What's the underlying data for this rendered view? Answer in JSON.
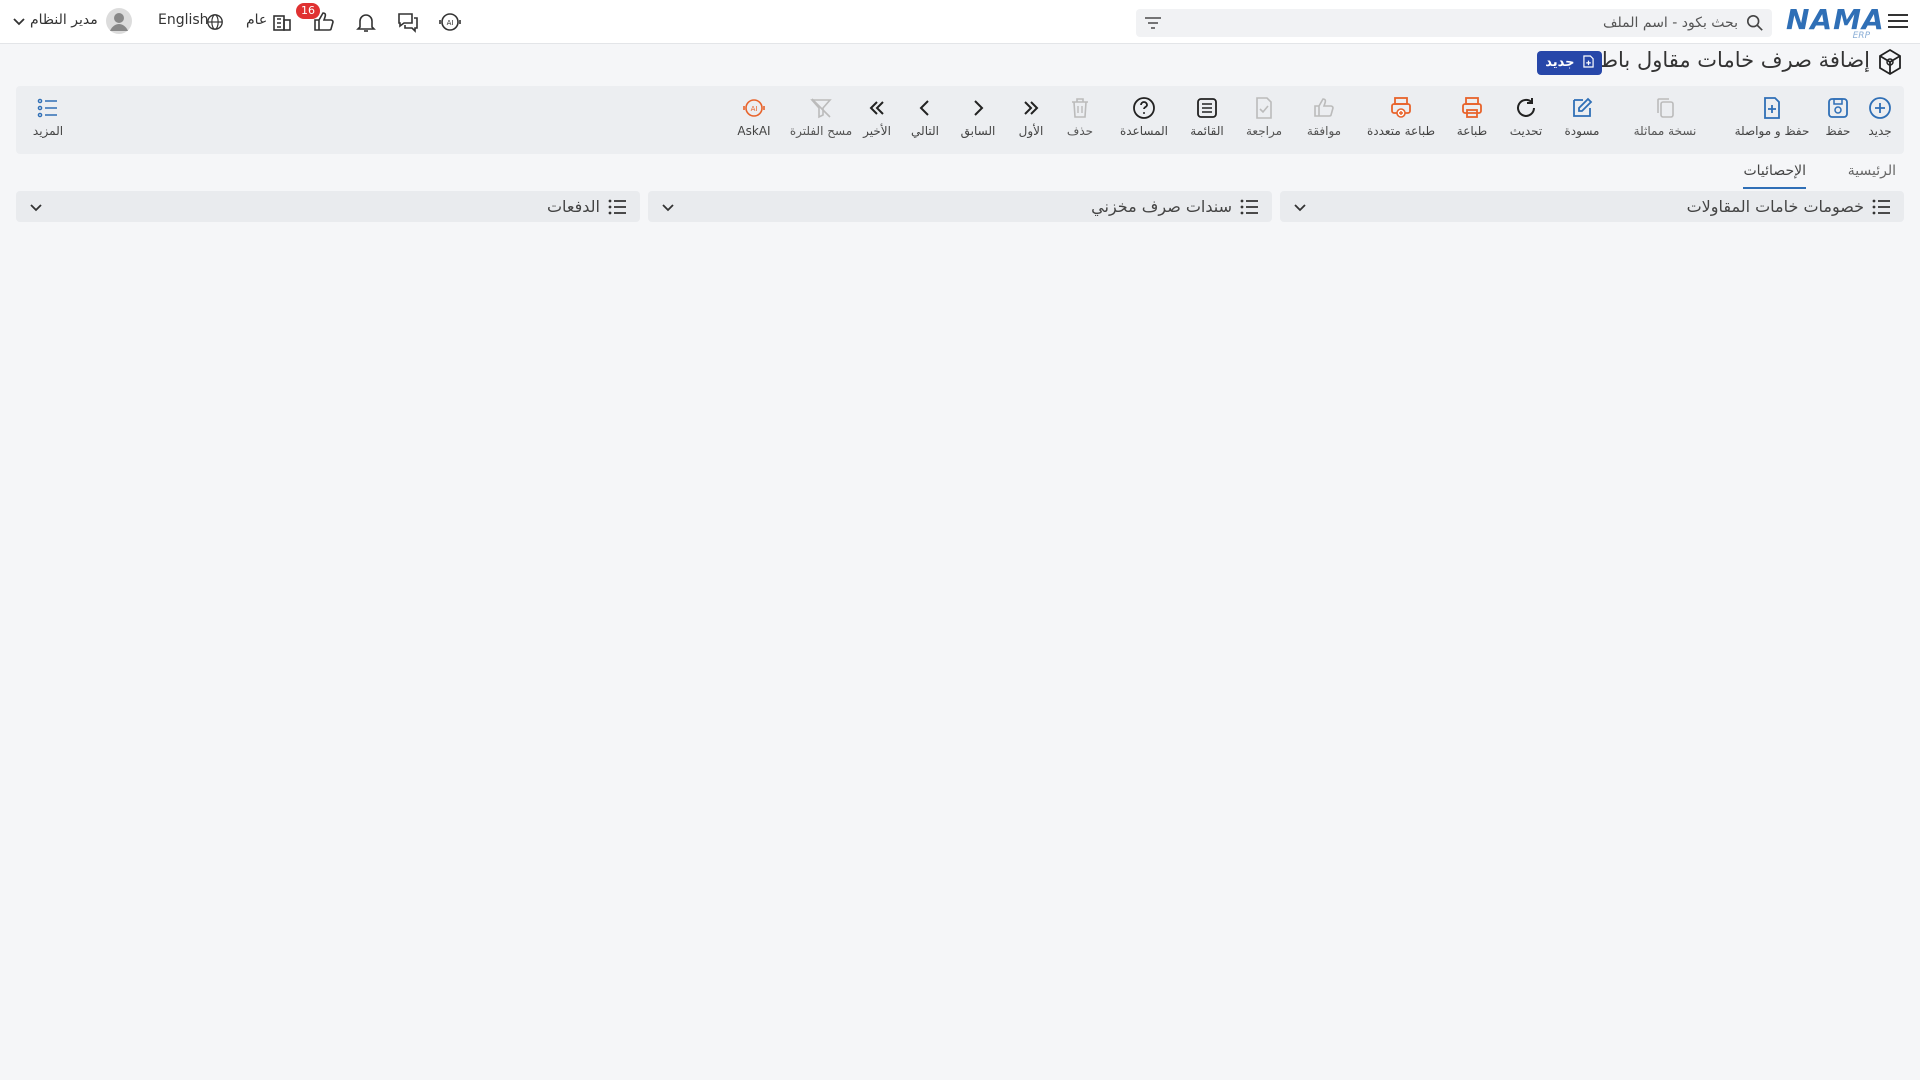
{
  "header": {
    "brand": "NAMA",
    "brand_sub": "ERP",
    "search_placeholder": "بحث بكود - اسم الملف",
    "notification_count": "16",
    "company_label": "عام",
    "language_label": "English",
    "user_name": "مدير النظام"
  },
  "page": {
    "title": "إضافة صرف خامات مقاول باطن",
    "status_badge": "جديد"
  },
  "toolbar": {
    "new": "جديد",
    "save": "حفظ",
    "save_continue": "حفظ و مواصلة",
    "duplicate": "نسخة مماثلة",
    "draft": "مسودة",
    "refresh": "تحديث",
    "print": "طباعة",
    "multi_print": "طباعة متعددة",
    "approve": "موافقة",
    "review": "مراجعة",
    "list": "القائمة",
    "help": "المساعدة",
    "delete": "حذف",
    "first": "الأول",
    "previous": "السابق",
    "next": "التالي",
    "last": "الأخير",
    "clear_filter": "مسح الفلترة",
    "ask_ai": "AskAI",
    "more": "المزيد"
  },
  "tabs": {
    "main": "الرئيسية",
    "statistics": "الإحصائيات"
  },
  "panels": {
    "contractor_deductions": "خصومات خامات المقاولات",
    "store_issue_docs": "سندات صرف مخزني",
    "payments": "الدفعات"
  },
  "colors": {
    "accent_blue": "#2f6fb6",
    "badge_navy": "#2747a9",
    "print_orange": "#e8632b",
    "badge_red": "#e03131"
  }
}
